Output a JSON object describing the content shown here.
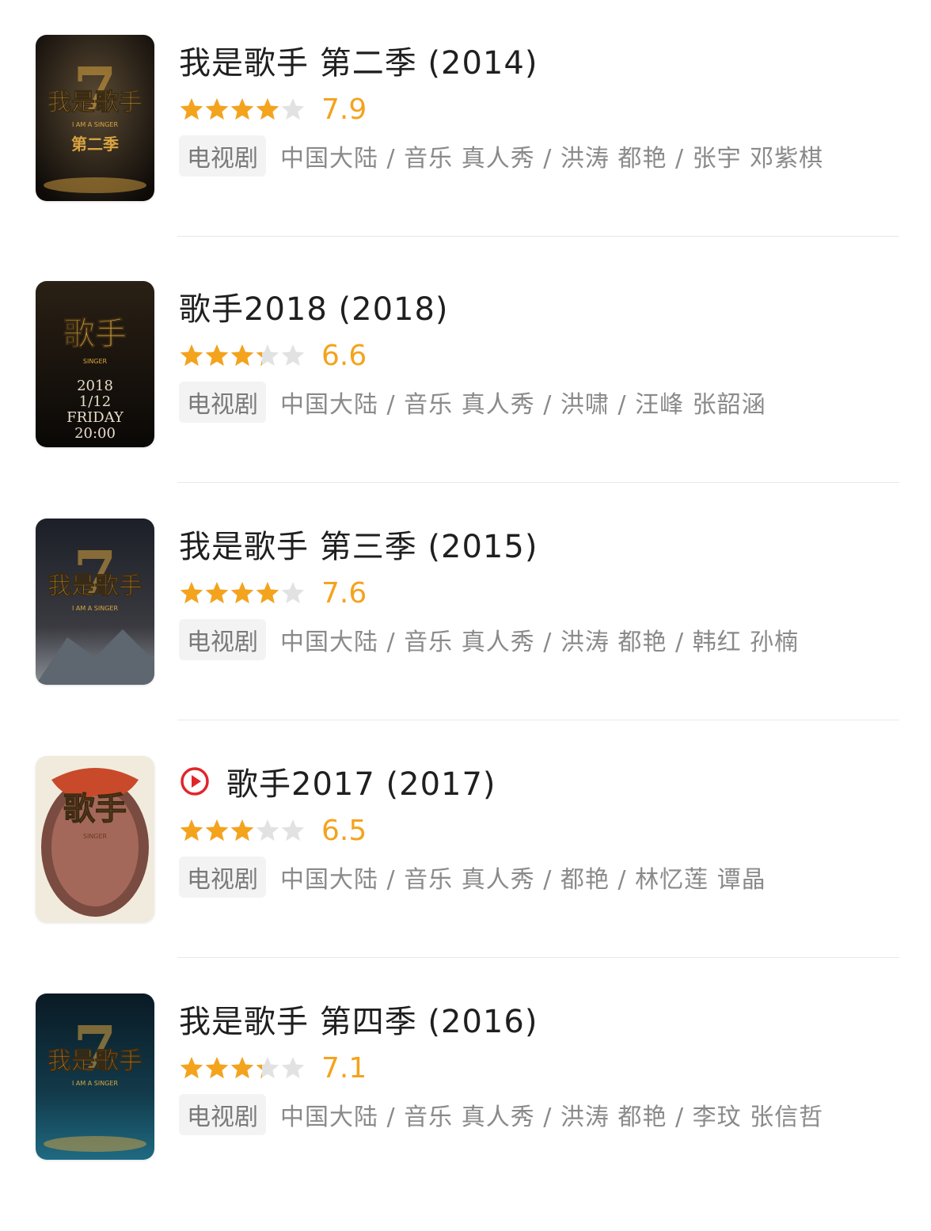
{
  "items": [
    {
      "title": "我是歌手 第二季 (2014)",
      "stars": 4,
      "score": "7.9",
      "tag": "电视剧",
      "info": "中国大陆 / 音乐 真人秀 / 洪涛 都艳 / 张宇 邓紫棋",
      "has_play_icon": false,
      "poster": {
        "logo": "我是歌手",
        "sub": "第二季",
        "tagline": "I AM A SINGER",
        "bg": "#1a1410"
      }
    },
    {
      "title": "歌手2018 (2018)",
      "stars": 3.5,
      "score": "6.6",
      "tag": "电视剧",
      "info": "中国大陆 / 音乐 真人秀 / 洪啸 / 汪峰 张韶涵",
      "has_play_icon": false,
      "poster": {
        "logo": "歌手",
        "sub": "2018 1/12 FRIDAY 20:00",
        "tagline": "SINGER",
        "bg": "#1b130c"
      }
    },
    {
      "title": "我是歌手 第三季 (2015)",
      "stars": 4,
      "score": "7.6",
      "tag": "电视剧",
      "info": "中国大陆 / 音乐 真人秀 / 洪涛 都艳 / 韩红 孙楠",
      "has_play_icon": false,
      "poster": {
        "logo": "我是歌手",
        "sub": "",
        "tagline": "I AM A SINGER",
        "bg": "#141a22"
      }
    },
    {
      "title": "歌手2017 (2017)",
      "stars": 3,
      "score": "6.5",
      "tag": "电视剧",
      "info": "中国大陆 / 音乐 真人秀 / 都艳 / 林忆莲 谭晶",
      "has_play_icon": true,
      "poster": {
        "logo": "歌手",
        "sub": "",
        "tagline": "SINGER",
        "bg": "#efe7d6"
      }
    },
    {
      "title": "我是歌手 第四季 (2016)",
      "stars": 3.5,
      "score": "7.1",
      "tag": "电视剧",
      "info": "中国大陆 / 音乐 真人秀 / 洪涛 都艳 / 李玟 张信哲",
      "has_play_icon": false,
      "poster": {
        "logo": "我是歌手",
        "sub": "",
        "tagline": "I AM A SINGER",
        "bg": "#0d2432"
      }
    }
  ],
  "colors": {
    "star_active": "#f4a31d",
    "star_inactive": "#e2e2e2",
    "play_icon": "#e0262a"
  },
  "icons": {
    "play": "play-circle-icon",
    "star": "star-icon"
  }
}
